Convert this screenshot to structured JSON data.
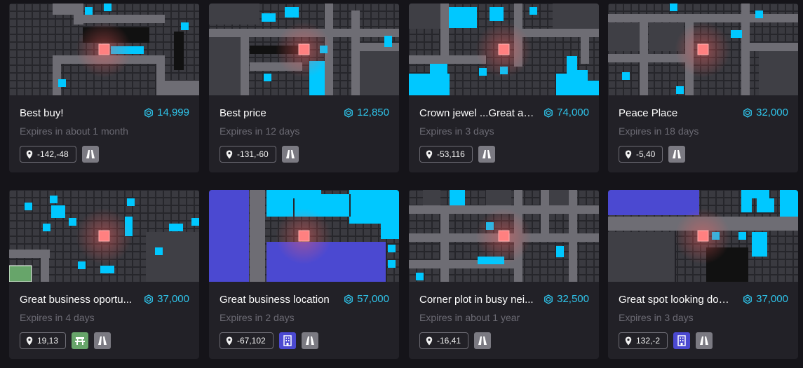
{
  "colors": {
    "page_bg": "#151419",
    "card_bg": "#222127",
    "accent": "#2fc4ea",
    "map_tile": "#2f2f35",
    "map_road": "#6e6d74",
    "map_selected": "#ff8080",
    "map_building": "#4b49d1",
    "map_park": "#67a56a"
  },
  "cards": [
    {
      "title": "Best buy!",
      "price": "14,999",
      "expires": "Expires in about 1 month",
      "coords": "-142,-48",
      "tags": [
        "road-icon"
      ]
    },
    {
      "title": "Best price",
      "price": "12,850",
      "expires": "Expires in 12 days",
      "coords": "-131,-60",
      "tags": [
        "road-icon"
      ]
    },
    {
      "title": "Crown jewel ...Great ad...",
      "price": "74,000",
      "expires": "Expires in 3 days",
      "coords": "-53,116",
      "tags": [
        "road-icon"
      ]
    },
    {
      "title": "Peace Place",
      "price": "32,000",
      "expires": "Expires in 18 days",
      "coords": "-5,40",
      "tags": [
        "road-icon"
      ]
    },
    {
      "title": "Great business oportu...",
      "price": "37,000",
      "expires": "Expires in 4 days",
      "coords": "19,13",
      "tags": [
        "park-icon",
        "road-icon"
      ]
    },
    {
      "title": "Great business location",
      "price": "57,000",
      "expires": "Expires in 2 days",
      "coords": "-67,102",
      "tags": [
        "building-icon",
        "road-icon"
      ]
    },
    {
      "title": "Corner plot in busy nei...",
      "price": "32,500",
      "expires": "Expires in about 1 year",
      "coords": "-16,41",
      "tags": [
        "road-icon"
      ]
    },
    {
      "title": "Great spot looking dow...",
      "price": "37,000",
      "expires": "Expires in 3 days",
      "coords": "132,-2",
      "tags": [
        "building-icon",
        "road-icon"
      ]
    }
  ]
}
